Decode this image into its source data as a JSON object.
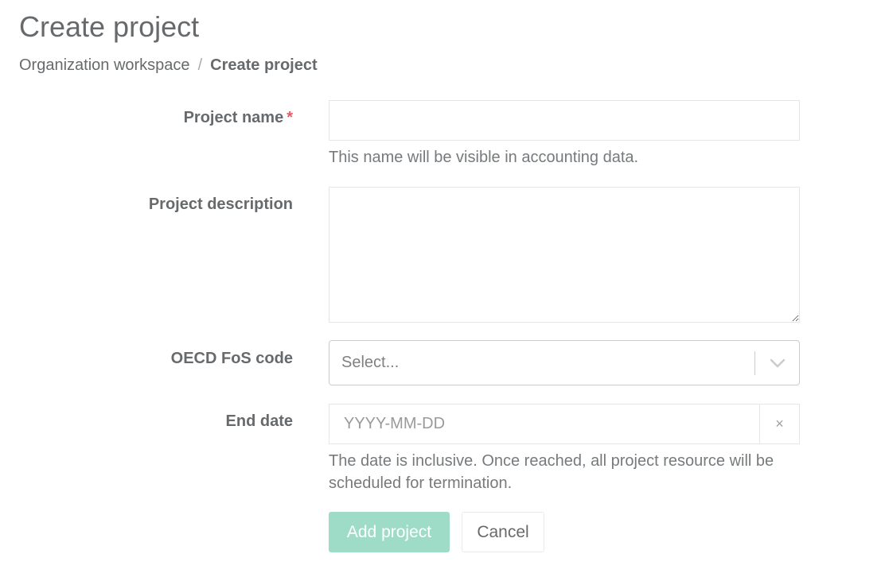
{
  "page": {
    "title": "Create project"
  },
  "breadcrumb": {
    "parent": "Organization workspace",
    "separator": "/",
    "current": "Create project"
  },
  "form": {
    "name": {
      "label": "Project name",
      "required_mark": "*",
      "value": "",
      "help": "This name will be visible in accounting data."
    },
    "description": {
      "label": "Project description",
      "value": ""
    },
    "oecd": {
      "label": "OECD FoS code",
      "placeholder": "Select...",
      "icon": "chevron-down-icon"
    },
    "end_date": {
      "label": "End date",
      "placeholder": "YYYY-MM-DD",
      "clear_symbol": "×",
      "help": "The date is inclusive. Once reached, all project resource will be scheduled for termination."
    }
  },
  "actions": {
    "submit_label": "Add project",
    "cancel_label": "Cancel"
  },
  "colors": {
    "primary_disabled": "#9fdcc8",
    "required": "#ed5565",
    "text": "#676a6c"
  }
}
